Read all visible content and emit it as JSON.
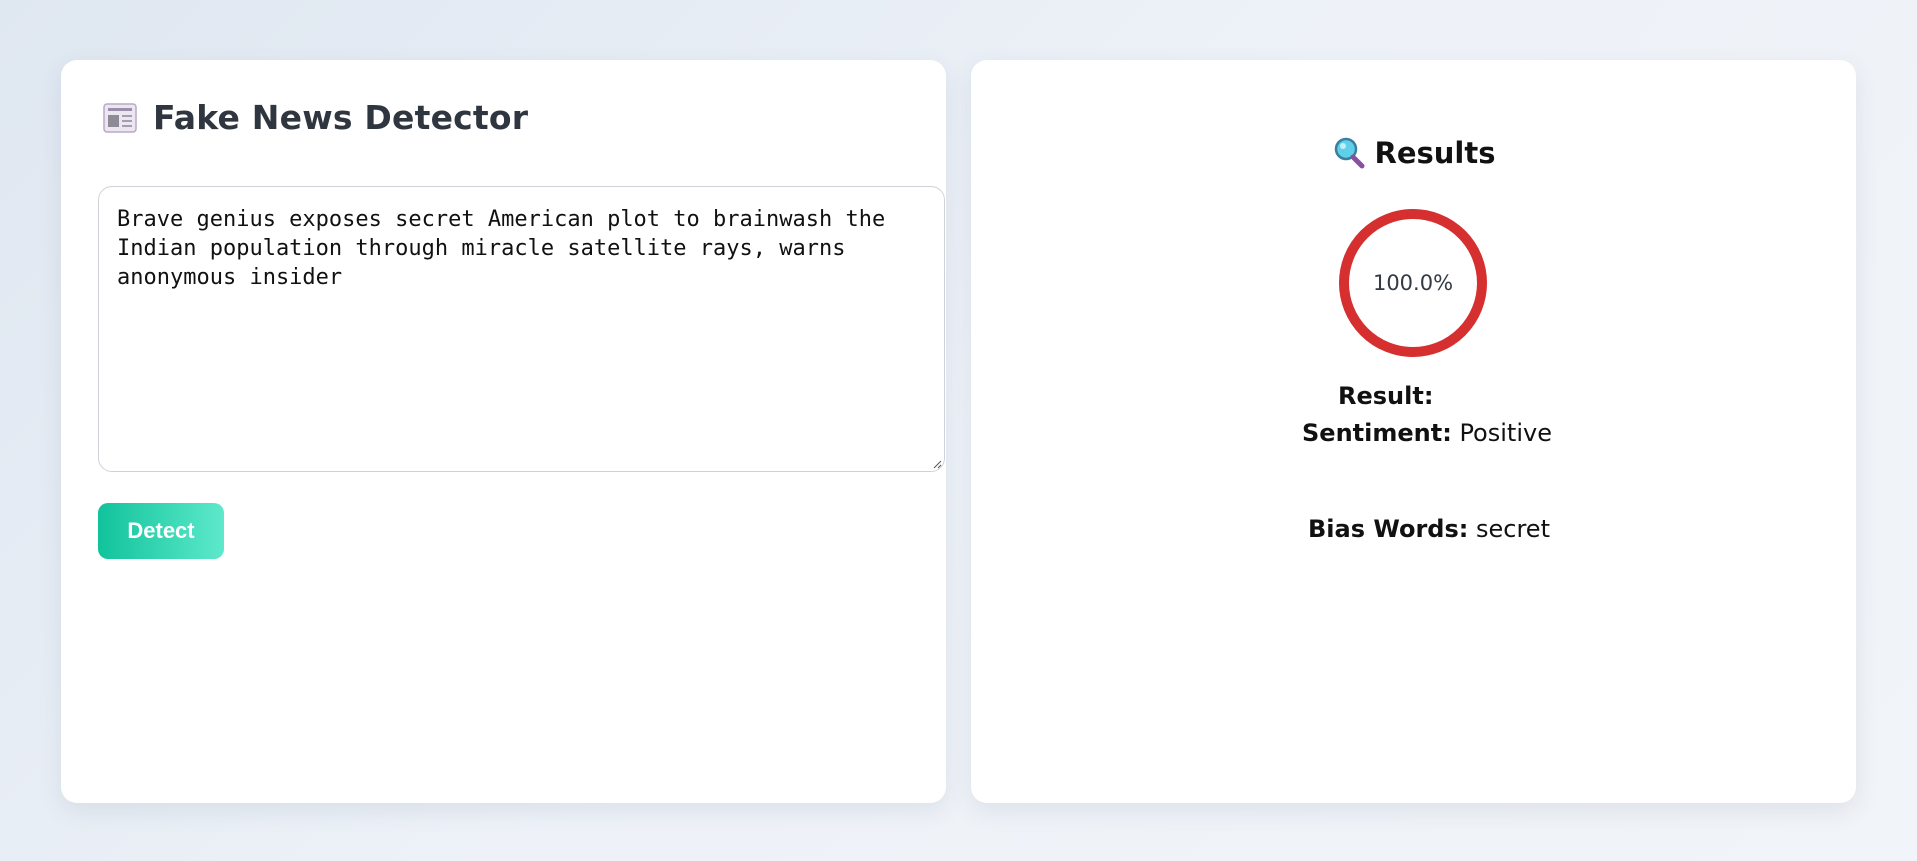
{
  "app": {
    "title": "Fake News Detector",
    "icon": "newspaper-icon"
  },
  "input": {
    "text": "Brave genius exposes secret American plot to brainwash the Indian population through miracle satellite rays, warns anonymous insider",
    "placeholder": ""
  },
  "detect_button": {
    "label": "Detect"
  },
  "results": {
    "title": "Results",
    "icon": "magnifying-glass-icon",
    "confidence_percent": 100.0,
    "confidence_label": "100.0%",
    "gauge_color": "#d62f2f",
    "result_label": "Result:",
    "result_value": "",
    "sentiment_label": "Sentiment:",
    "sentiment_value": "Positive",
    "bias_words_label": "Bias Words:",
    "bias_words_value": "secret"
  },
  "colors": {
    "accent_start": "#11c39b",
    "accent_end": "#5de9cb",
    "title_text": "#2f3640"
  }
}
